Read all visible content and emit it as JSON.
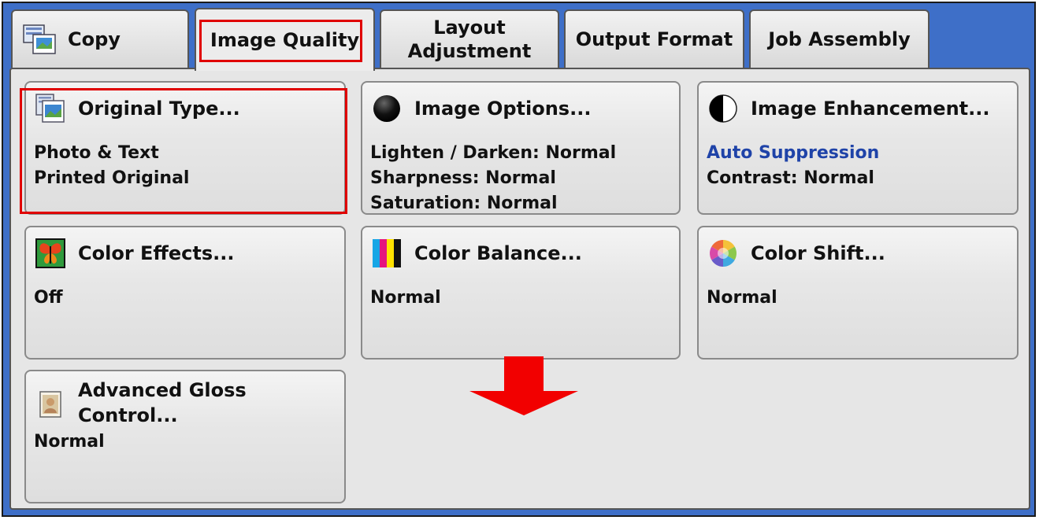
{
  "tabs": [
    {
      "label": "Copy"
    },
    {
      "label": "Image Quality"
    },
    {
      "label_line1": "Layout",
      "label_line2": "Adjustment"
    },
    {
      "label": "Output Format"
    },
    {
      "label": "Job Assembly"
    }
  ],
  "buttons": {
    "original_type": {
      "title": "Original Type...",
      "lines": [
        "Photo & Text",
        "Printed Original"
      ]
    },
    "image_options": {
      "title": "Image Options...",
      "lines": [
        "Lighten / Darken: Normal",
        "Sharpness: Normal",
        "Saturation: Normal"
      ]
    },
    "image_enhancement": {
      "title": "Image Enhancement...",
      "lines": [
        "Auto Suppression",
        "Contrast: Normal"
      ]
    },
    "color_effects": {
      "title": "Color Effects...",
      "lines": [
        "Off"
      ]
    },
    "color_balance": {
      "title": "Color Balance...",
      "lines": [
        "Normal"
      ]
    },
    "color_shift": {
      "title": "Color Shift...",
      "lines": [
        "Normal"
      ]
    },
    "advanced_gloss": {
      "title_line1": "Advanced Gloss",
      "title_line2": "Control...",
      "lines": [
        "Normal"
      ]
    }
  },
  "colors": {
    "frame": "#3e6fc8",
    "highlight": "#e00000",
    "auto_suppression_text": "#1f43a8"
  },
  "icons": {
    "copy_tab": "copy-icon",
    "original_type": "document-photo-icon",
    "image_options": "black-sphere-icon",
    "image_enhancement": "half-contrast-icon",
    "color_effects": "butterfly-icon",
    "color_balance": "cmyk-bars-icon",
    "color_shift": "color-wheel-icon",
    "advanced_gloss": "gloss-photo-icon",
    "scroll_indicator": "down-arrow-icon"
  }
}
